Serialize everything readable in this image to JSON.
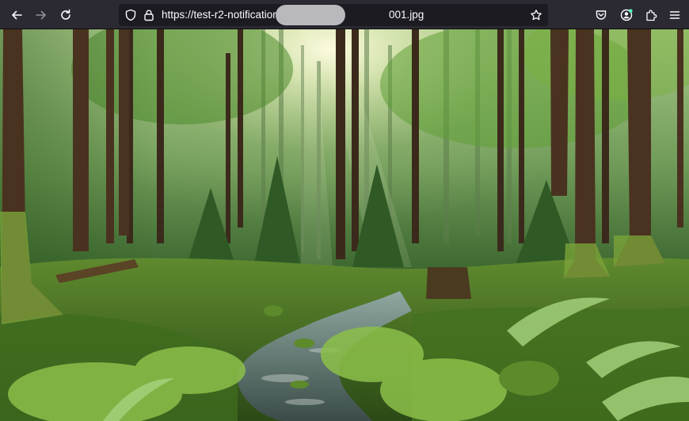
{
  "toolbar": {
    "back_icon": "back-arrow-icon",
    "forward_icon": "forward-arrow-icon",
    "reload_icon": "reload-icon"
  },
  "urlbar": {
    "url_visible_start": "https://test-r2-notification",
    "url_visible_end": "001.jpg",
    "redacted": true,
    "tracking_icon": "shield-icon",
    "lock_icon": "lock-icon",
    "bookmark_icon": "star-icon"
  },
  "right_icons": [
    "pocket-icon",
    "account-icon",
    "extensions-icon",
    "menu-icon"
  ],
  "colors": {
    "toolbar_bg": "#2b2a33",
    "urlbar_bg": "#1c1b22",
    "account_badge": "#54ffbd"
  },
  "image": {
    "subject": "forest"
  }
}
